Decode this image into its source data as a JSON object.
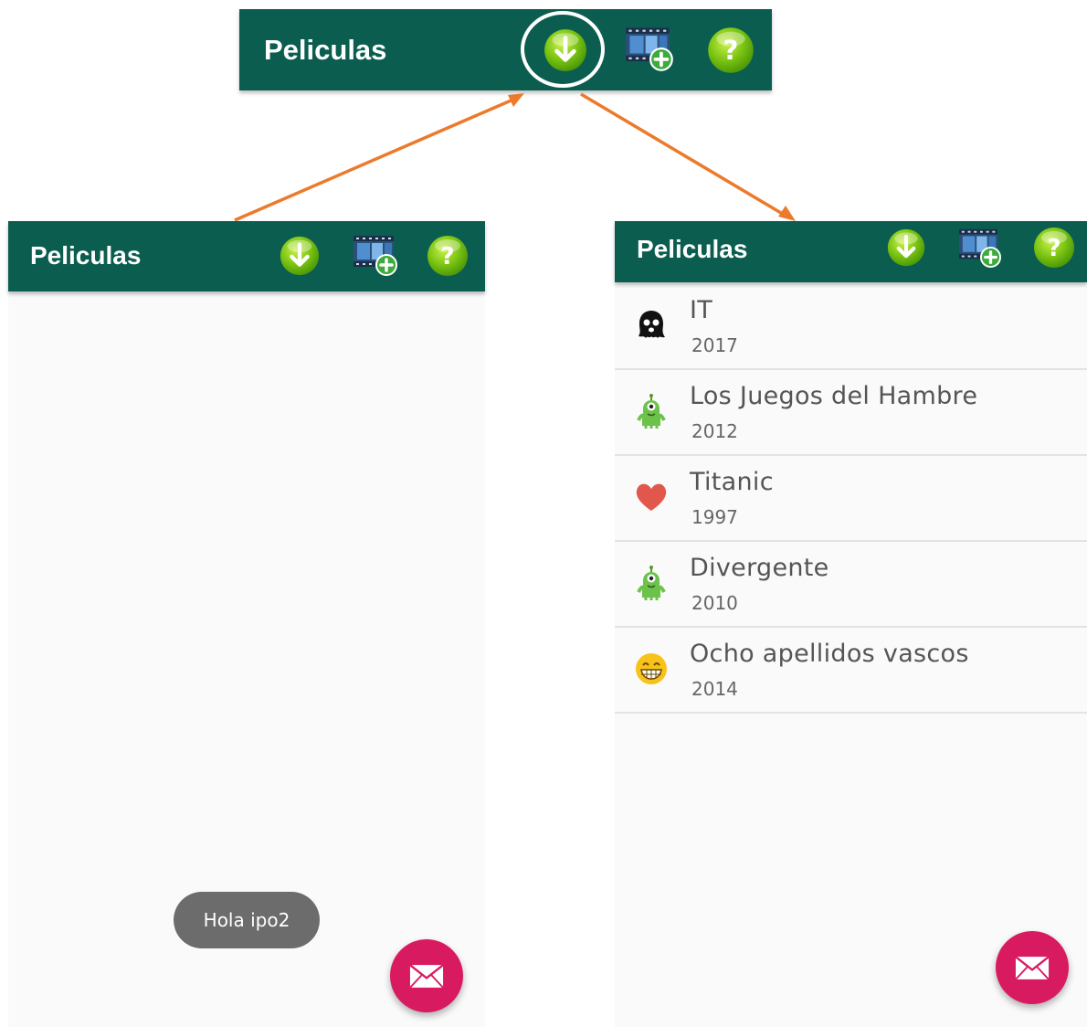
{
  "colors": {
    "toolbar": "#0b5e4f",
    "fab": "#d81b60",
    "arrow": "#ec7a2c",
    "icon_green": "#8fd11a"
  },
  "top_panel": {
    "title": "Peliculas",
    "icons": [
      "download-icon",
      "add-movie-icon",
      "help-icon"
    ]
  },
  "left_panel": {
    "title": "Peliculas",
    "icons": [
      "download-icon",
      "add-movie-icon",
      "help-icon"
    ],
    "toast": "Hola ipo2",
    "fab_icon": "mail-icon"
  },
  "right_panel": {
    "title": "Peliculas",
    "icons": [
      "download-icon",
      "add-movie-icon",
      "help-icon"
    ],
    "movies": [
      {
        "title": "IT",
        "year": "2017",
        "icon": "ghost-icon"
      },
      {
        "title": "Los Juegos del Hambre",
        "year": "2012",
        "icon": "alien-icon"
      },
      {
        "title": "Titanic",
        "year": "1997",
        "icon": "heart-icon"
      },
      {
        "title": "Divergente",
        "year": "2010",
        "icon": "alien-icon"
      },
      {
        "title": "Ocho apellidos vascos",
        "year": "2014",
        "icon": "grin-icon"
      }
    ],
    "fab_icon": "mail-icon"
  }
}
